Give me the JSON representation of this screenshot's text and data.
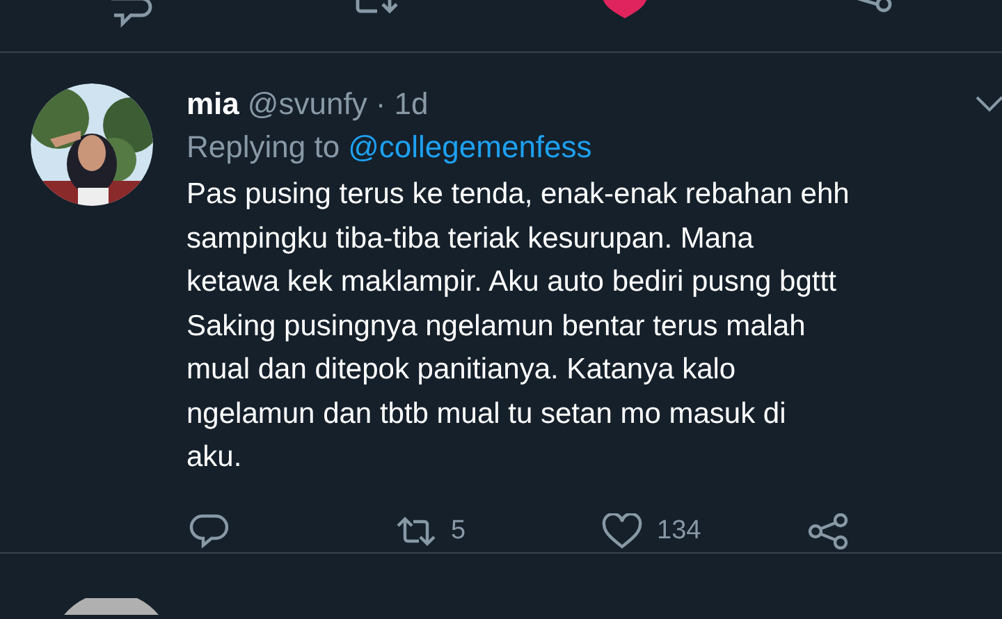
{
  "previous_tweet": {
    "liked": true
  },
  "tweet": {
    "name": "mia",
    "handle": "@svunfy",
    "time": "· 1d",
    "replying_label": "Replying to",
    "replying_to": "@collegemenfess",
    "text": "Pas pusing terus ke tenda, enak-enak rebahan ehh\nsampingku tiba-tiba teriak kesurupan. Mana\nketawa kek maklampir. Aku auto bediri pusng bgttt\nSaking pusingnya ngelamun bentar terus malah\nmual dan ditepok panitianya. Katanya kalo\nngelamun dan tbtb mual tu setan mo masuk di\naku.",
    "retweets": "5",
    "likes": "134",
    "liked": false
  }
}
